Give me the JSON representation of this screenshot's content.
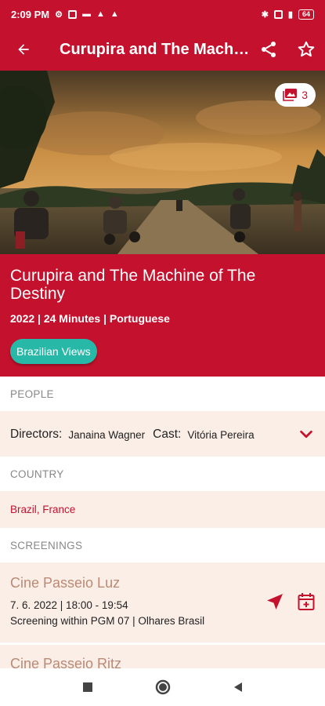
{
  "status_bar": {
    "time": "2:09 PM",
    "battery": "64"
  },
  "app_bar": {
    "title": "Curupira and The Machine of The Destiny"
  },
  "hero": {
    "photo_count": "3"
  },
  "movie": {
    "title": "Curupira and The Machine of The Destiny",
    "meta": "2022 | 24 Minutes | Portuguese",
    "category": "Brazilian Views"
  },
  "sections": {
    "people": "PEOPLE",
    "country": "COUNTRY",
    "screenings": "SCREENINGS"
  },
  "people": {
    "directors_label": "Directors:",
    "directors": "Janaina Wagner",
    "cast_label": "Cast:",
    "cast": "Vitória Pereira"
  },
  "country": "Brazil, France",
  "screenings": [
    {
      "venue": "Cine Passeio Luz",
      "time": "7. 6. 2022 | 18:00 - 19:54",
      "program": "Screening within PGM 07 | Olhares Brasil"
    },
    {
      "venue": "Cine Passeio Ritz"
    }
  ],
  "colors": {
    "brand": "#c4122e",
    "chip": "#27b8a8",
    "row_bg": "#fbeee7",
    "venue": "#b98a76"
  }
}
